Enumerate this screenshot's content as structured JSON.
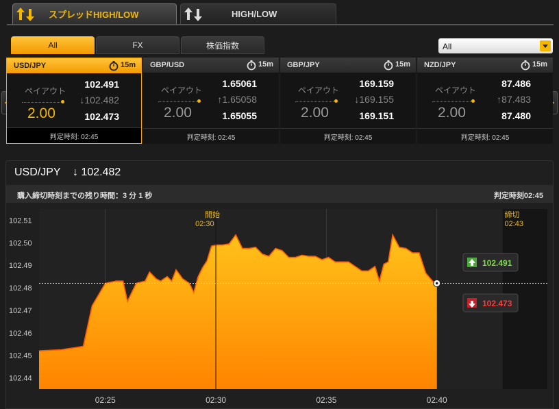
{
  "tabs": [
    {
      "label": "スプレッドHIGH/LOW",
      "active": true
    },
    {
      "label": "HIGH/LOW",
      "active": false
    }
  ],
  "subtabs": [
    {
      "label": "All",
      "active": true
    },
    {
      "label": "FX",
      "active": false
    },
    {
      "label": "株価指数",
      "active": false
    }
  ],
  "filter": {
    "selected": "All"
  },
  "cards": [
    {
      "pair": "USD/JPY",
      "duration": "15m",
      "payout_label": "ペイアウト",
      "payout": "2.00",
      "high": "102.491",
      "current": "↓102.482",
      "low": "102.473",
      "judge": "判定時刻: 02:45",
      "active": true
    },
    {
      "pair": "GBP/USD",
      "duration": "15m",
      "payout_label": "ペイアウト",
      "payout": "2.00",
      "high": "1.65061",
      "current": "↑1.65058",
      "low": "1.65055",
      "judge": "判定時刻: 02:45",
      "active": false
    },
    {
      "pair": "GBP/JPY",
      "duration": "15m",
      "payout_label": "ペイアウト",
      "payout": "2.00",
      "high": "169.159",
      "current": "↓169.155",
      "low": "169.151",
      "judge": "判定時刻: 02:45",
      "active": false
    },
    {
      "pair": "NZD/JPY",
      "duration": "15m",
      "payout_label": "ペイアウト",
      "payout": "2.00",
      "high": "87.486",
      "current": "↑87.483",
      "low": "87.480",
      "judge": "判定時刻: 02:45",
      "active": false
    }
  ],
  "panel": {
    "title": "USD/JPY",
    "value": "↓ 102.482",
    "remaining": "購入締切時刻までの残り時間：3 分 1 秒",
    "judge_time": "判定時刻02:45"
  },
  "chart_data": {
    "type": "area",
    "x_ticks": [
      "02:25",
      "02:30",
      "02:35",
      "02:40"
    ],
    "y_ticks": [
      102.44,
      102.45,
      102.46,
      102.47,
      102.48,
      102.49,
      102.5,
      102.51
    ],
    "ylim": [
      102.435,
      102.515
    ],
    "xlim_min": [
      22.0,
      45.0
    ],
    "start_label": "開始",
    "start_time": "02:30",
    "close_label": "締切",
    "close_time": "02:43",
    "current": 102.482,
    "high_label": "102.491",
    "low_label": "102.473",
    "color": "#ff9a00",
    "x": [
      22.0,
      23.0,
      24.0,
      24.4,
      25.0,
      25.5,
      25.8,
      26.0,
      26.4,
      26.8,
      27.0,
      27.3,
      27.5,
      27.8,
      28.0,
      28.2,
      28.5,
      28.8,
      29.0,
      29.2,
      29.4,
      29.6,
      29.8,
      30.0,
      30.3,
      30.6,
      30.9,
      31.2,
      31.5,
      31.8,
      32.1,
      32.4,
      32.7,
      33.0,
      33.3,
      33.6,
      33.9,
      34.2,
      34.5,
      34.8,
      35.1,
      35.4,
      35.7,
      36.0,
      36.3,
      36.6,
      36.9,
      37.2,
      37.4,
      37.6,
      37.8,
      38.0,
      38.3,
      38.6,
      38.9,
      39.2,
      39.5,
      39.8,
      40.0
    ],
    "y": [
      102.452,
      102.4525,
      102.454,
      102.472,
      102.482,
      102.483,
      102.483,
      102.474,
      102.482,
      102.483,
      102.487,
      102.484,
      102.483,
      102.485,
      102.483,
      102.488,
      102.484,
      102.482,
      102.478,
      102.485,
      102.489,
      102.492,
      102.4985,
      102.499,
      102.499,
      102.4995,
      102.5035,
      102.4975,
      102.4975,
      102.498,
      102.495,
      102.494,
      102.4975,
      102.4965,
      102.4935,
      102.4935,
      102.4945,
      102.494,
      102.494,
      102.4925,
      102.4935,
      102.4915,
      102.4915,
      102.4915,
      102.4895,
      102.4875,
      102.4875,
      102.4895,
      102.483,
      102.4905,
      102.4915,
      102.5035,
      102.498,
      102.4975,
      102.4955,
      102.4955,
      102.4865,
      102.483,
      102.482
    ]
  }
}
